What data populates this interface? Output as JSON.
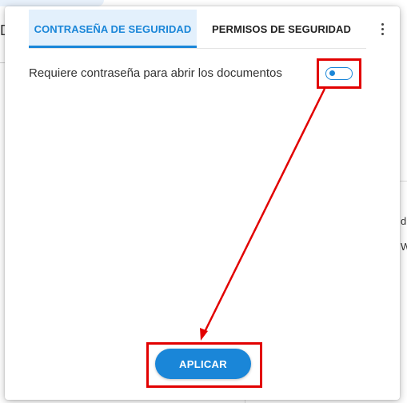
{
  "background": {
    "letter_left": "D",
    "letter_right_1": "d",
    "letter_right_2": "W"
  },
  "dialog": {
    "tabs": [
      {
        "label": "CONTRASEÑA DE SEGURIDAD",
        "active": true
      },
      {
        "label": "PERMISOS DE SEGURIDAD",
        "active": false
      }
    ],
    "more_icon": "more-vert-icon",
    "option": {
      "label": "Requiere contraseña para abrir los documentos",
      "enabled": false
    },
    "apply_label": "APLICAR"
  },
  "colors": {
    "accent": "#1a86d8",
    "active_tab_bg": "#e3f0fc",
    "annotation": "#e20000"
  }
}
